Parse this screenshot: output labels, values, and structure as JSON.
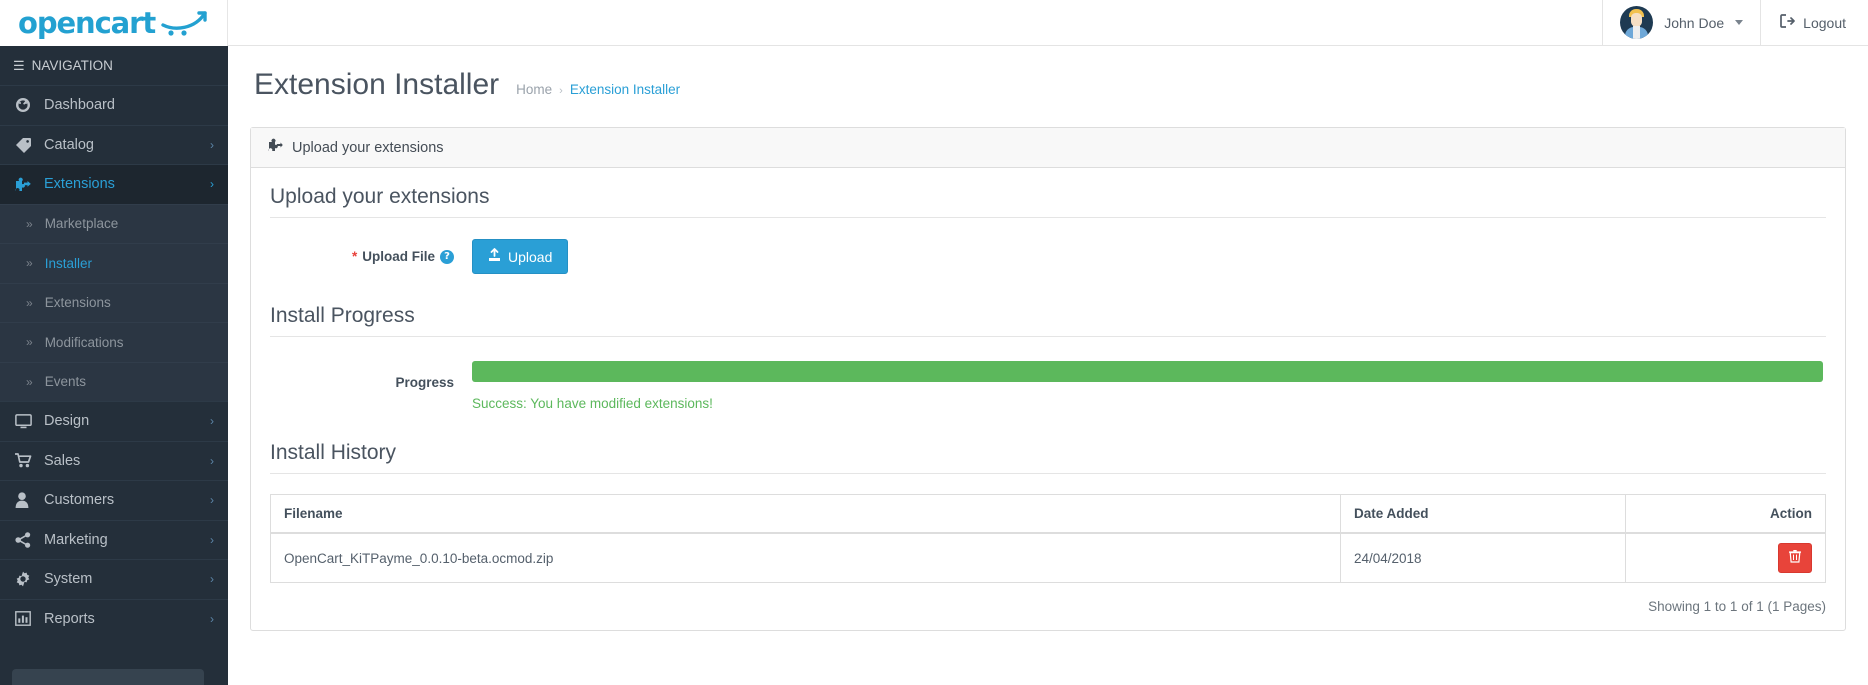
{
  "brand": {
    "name": "opencart",
    "cart_icon": "shopping-cart-swoosh-icon"
  },
  "topbar": {
    "user_name": "John Doe",
    "caret_icon": "caret-down-icon",
    "avatar_icon": "user-avatar",
    "logout_label": "Logout",
    "logout_icon": "logout-icon"
  },
  "sidebar": {
    "header": "NAVIGATION",
    "burger_icon": "hamburger-icon",
    "items": [
      {
        "label": "Dashboard",
        "icon": "dashboard-icon",
        "has_children": false,
        "active": false
      },
      {
        "label": "Catalog",
        "icon": "tag-icon",
        "has_children": true,
        "active": false
      },
      {
        "label": "Extensions",
        "icon": "puzzle-icon",
        "has_children": true,
        "active": true
      },
      {
        "label": "Design",
        "icon": "monitor-icon",
        "has_children": true,
        "active": false
      },
      {
        "label": "Sales",
        "icon": "cart-icon",
        "has_children": true,
        "active": false
      },
      {
        "label": "Customers",
        "icon": "user-icon",
        "has_children": true,
        "active": false
      },
      {
        "label": "Marketing",
        "icon": "share-icon",
        "has_children": true,
        "active": false
      },
      {
        "label": "System",
        "icon": "gear-icon",
        "has_children": true,
        "active": false
      },
      {
        "label": "Reports",
        "icon": "bar-chart-icon",
        "has_children": true,
        "active": false
      }
    ],
    "extensions_submenu": [
      {
        "label": "Marketplace",
        "active": false
      },
      {
        "label": "Installer",
        "active": true
      },
      {
        "label": "Extensions",
        "active": false
      },
      {
        "label": "Modifications",
        "active": false
      },
      {
        "label": "Events",
        "active": false
      }
    ]
  },
  "page": {
    "title": "Extension Installer",
    "breadcrumb": [
      {
        "label": "Home",
        "current": false
      },
      {
        "label": "Extension Installer",
        "current": true
      }
    ],
    "breadcrumb_separator": "›"
  },
  "panel": {
    "header_label": "Upload your extensions",
    "header_icon": "puzzle-icon",
    "legend": "Upload your extensions",
    "upload": {
      "required_mark": "*",
      "label": "Upload File",
      "help_icon": "question-circle-icon",
      "help_glyph": "?",
      "button_label": "Upload",
      "button_icon": "upload-icon"
    },
    "install_progress": {
      "title": "Install Progress",
      "label": "Progress",
      "percent": 100,
      "success_message": "Success: You have modified extensions!",
      "bar_color": "#5cb85c"
    },
    "install_history": {
      "title": "Install History",
      "columns": [
        "Filename",
        "Date Added",
        "Action"
      ],
      "rows": [
        {
          "filename": "OpenCart_KiTPayme_0.0.10-beta.ocmod.zip",
          "date_added": "24/04/2018",
          "action_icon": "trash-icon"
        }
      ],
      "results_text": "Showing 1 to 1 of 1 (1 Pages)"
    }
  },
  "colors": {
    "brand_blue": "#23a1d1",
    "accent_blue": "#2a9fd6",
    "success_green": "#5cb85c",
    "danger_red": "#e8443a",
    "sidebar_bg": "#242f3a"
  }
}
